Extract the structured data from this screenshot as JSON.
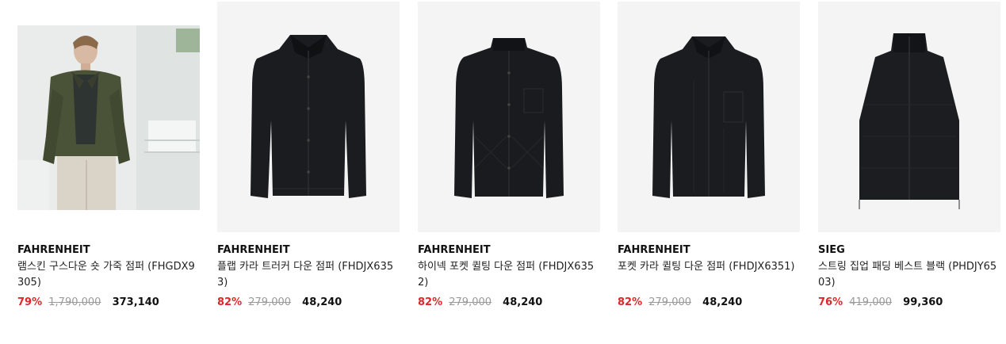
{
  "products": [
    {
      "brand": "FAHRENHEIT",
      "name": "램스킨 구스다운 숏 가죽 점퍼 (FHGDX9305)",
      "discount": "79%",
      "original_price": "1,790,000",
      "sale_price": "373,140",
      "image": "model-wearing-olive-leather-jacket"
    },
    {
      "brand": "FAHRENHEIT",
      "name": "플랩 카라 트러커 다운 점퍼 (FHDJX6353)",
      "discount": "82%",
      "original_price": "279,000",
      "sale_price": "48,240",
      "image": "black-collared-jacket"
    },
    {
      "brand": "FAHRENHEIT",
      "name": "하이넥 포켓 퀼팅 다운 점퍼 (FHDJX6352)",
      "discount": "82%",
      "original_price": "279,000",
      "sale_price": "48,240",
      "image": "black-quilted-highneck-jacket"
    },
    {
      "brand": "FAHRENHEIT",
      "name": "포켓 카라 퀼팅 다운 점퍼 (FHDJX6351)",
      "discount": "82%",
      "original_price": "279,000",
      "sale_price": "48,240",
      "image": "black-quilted-collar-jacket"
    },
    {
      "brand": "SIEG",
      "name": "스트링 집업 패딩 베스트 블랙 (PHDJY6503)",
      "discount": "76%",
      "original_price": "419,000",
      "sale_price": "99,360",
      "image": "black-padded-vest"
    }
  ],
  "colors": {
    "discount": "#e0262b",
    "original_price": "#9a9a9a",
    "thumb_bg": "#f4f4f4",
    "garment": "#1b1c1f"
  }
}
